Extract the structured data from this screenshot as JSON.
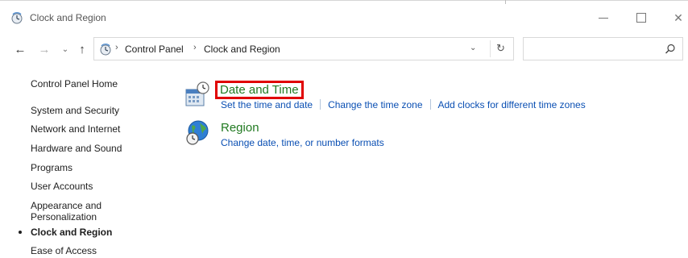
{
  "window": {
    "title": "Clock and Region",
    "colors": {
      "link": "#0a4fb3",
      "category_title": "#217a21",
      "highlight": "#e00000"
    }
  },
  "address": {
    "crumbs": [
      "Control Panel",
      "Clock and Region"
    ],
    "search_placeholder": ""
  },
  "sidebar": {
    "items": [
      {
        "label": "Control Panel Home"
      },
      {
        "label": "System and Security"
      },
      {
        "label": "Network and Internet"
      },
      {
        "label": "Hardware and Sound"
      },
      {
        "label": "Programs"
      },
      {
        "label": "User Accounts"
      },
      {
        "label": "Appearance and"
      },
      {
        "label": "Personalization"
      },
      {
        "label": "Clock and Region",
        "active": true
      },
      {
        "label": "Ease of Access"
      }
    ]
  },
  "main": {
    "categories": [
      {
        "title": "Date and Time",
        "icon": "calendar-clock-icon",
        "links": [
          "Set the time and date",
          "Change the time zone",
          "Add clocks for different time zones"
        ]
      },
      {
        "title": "Region",
        "icon": "globe-clock-icon",
        "links": [
          "Change date, time, or number formats"
        ]
      }
    ]
  }
}
